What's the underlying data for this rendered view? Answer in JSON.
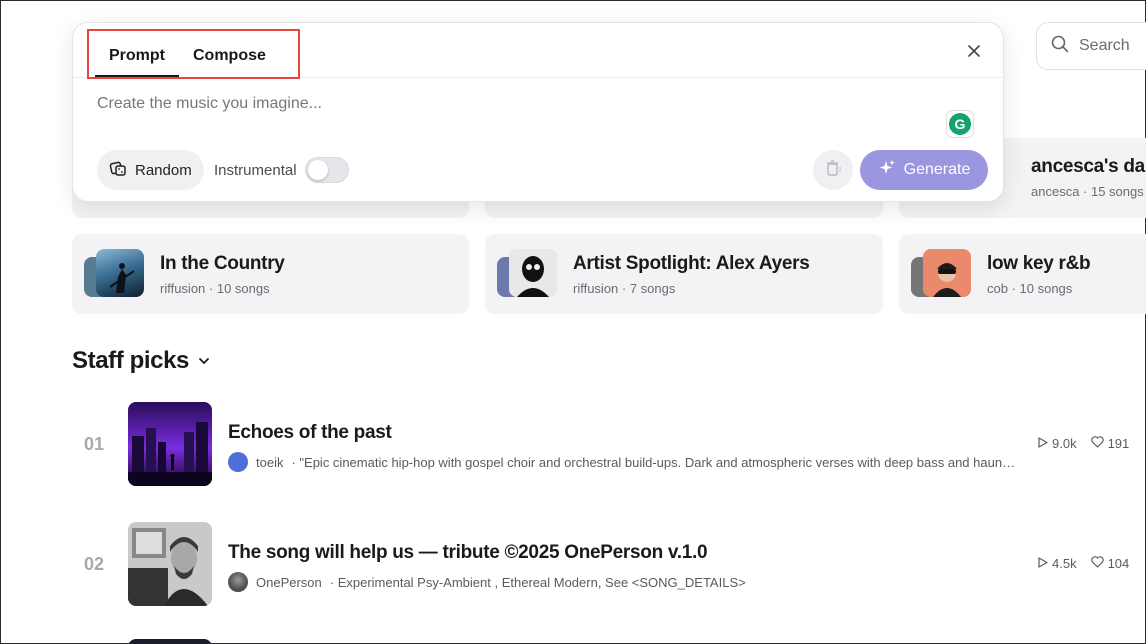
{
  "search": {
    "label": "Search"
  },
  "modal": {
    "tabs": [
      {
        "label": "Prompt"
      },
      {
        "label": "Compose"
      }
    ],
    "placeholder": "Create the music you imagine...",
    "random_label": "Random",
    "instrumental_label": "Instrumental",
    "instrumental_on": false,
    "generate_label": "Generate"
  },
  "playlists_top": [
    {
      "title": ""
    },
    {
      "title": ""
    },
    {
      "title": "ancesca's dance",
      "sub": "ancesca · 15 songs"
    }
  ],
  "playlists": [
    {
      "title": "In the Country",
      "sub": "riffusion · 10 songs"
    },
    {
      "title": "Artist Spotlight: Alex Ayers",
      "sub": "riffusion · 7 songs"
    },
    {
      "title": "low key r&b",
      "sub": "cob · 10 songs"
    }
  ],
  "staff_picks": {
    "title": "Staff picks",
    "tracks": [
      {
        "num": "01",
        "title": "Echoes of the past",
        "author": "toeik",
        "desc": "· \"Epic cinematic hip-hop with gospel choir and orchestral build-ups. Dark and atmospheric verses with deep bass and haunti…",
        "plays": "9.0k",
        "likes": "191"
      },
      {
        "num": "02",
        "title": "The song will help us — tribute ©2025 OnePerson v.1.0",
        "author": "OnePerson",
        "desc": "· Experimental Psy-Ambient , Ethereal Modern, See <SONG_DETAILS>",
        "plays": "4.5k",
        "likes": "104"
      }
    ]
  },
  "colors": {
    "accent": "#9a96e0",
    "highlight": "#e8453c"
  }
}
